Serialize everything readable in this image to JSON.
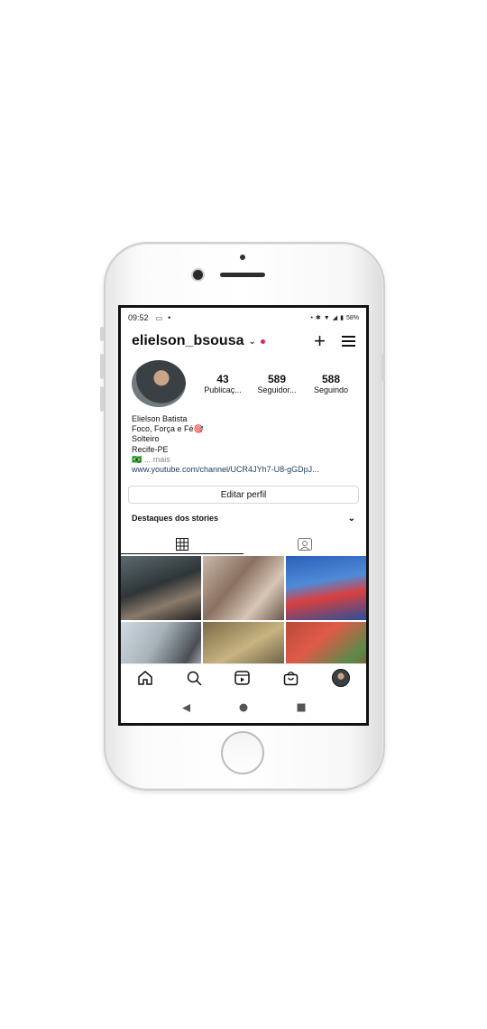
{
  "status_bar": {
    "time": "09:52",
    "battery": "58%"
  },
  "profile": {
    "username": "elielson_bsousa",
    "stats": [
      {
        "value": "43",
        "label": "Publicaç..."
      },
      {
        "value": "589",
        "label": "Seguidor..."
      },
      {
        "value": "588",
        "label": "Seguindo"
      }
    ],
    "bio": {
      "name": "Elielson Batista",
      "line1": "Foco, Força e Fé🎯",
      "line2": "Solteiro",
      "line3": "Recife-PE",
      "flag": "🇧🇷",
      "more": "... mais",
      "link": "www.youtube.com/channel/UCR4JYh7-U8-gGDpJ..."
    }
  },
  "buttons": {
    "edit_profile": "Editar perfil"
  },
  "highlights": {
    "title": "Destaques dos stories"
  },
  "colors": {
    "accent": "#e0245e",
    "link": "#1c3a5b"
  }
}
